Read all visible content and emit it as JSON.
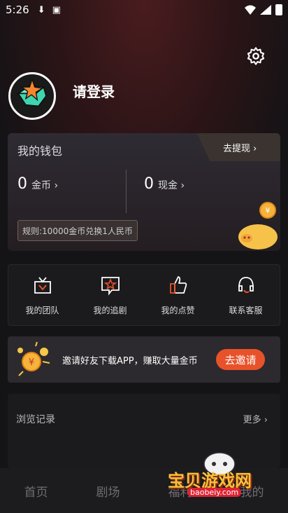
{
  "status_bar": {
    "time": "5:26"
  },
  "profile": {
    "login_label": "请登录"
  },
  "wallet": {
    "title": "我的钱包",
    "withdraw_label": "去提现 ›",
    "coins": {
      "value": "0",
      "label": "金币 ›"
    },
    "cash": {
      "value": "0",
      "label": "现金 ›"
    },
    "rule": "规则:10000金币兑换1人民币"
  },
  "menu": [
    {
      "label": "我的团队",
      "icon": "team-icon"
    },
    {
      "label": "我的追剧",
      "icon": "star-icon"
    },
    {
      "label": "我的点赞",
      "icon": "thumbs-up-icon"
    },
    {
      "label": "联系客服",
      "icon": "headset-icon"
    }
  ],
  "invite": {
    "text": "邀请好友下载APP，赚取大量金币",
    "button": "去邀请"
  },
  "history": {
    "title": "浏览记录",
    "more": "更多 ›"
  },
  "tabs": [
    {
      "label": "首页"
    },
    {
      "label": "剧场"
    },
    {
      "label": "福利"
    },
    {
      "label": "我的"
    }
  ],
  "watermark": {
    "text": "宝贝游戏网",
    "url": "baobeiy.com"
  },
  "colors": {
    "accent": "#e8522a",
    "background": "#141316"
  }
}
